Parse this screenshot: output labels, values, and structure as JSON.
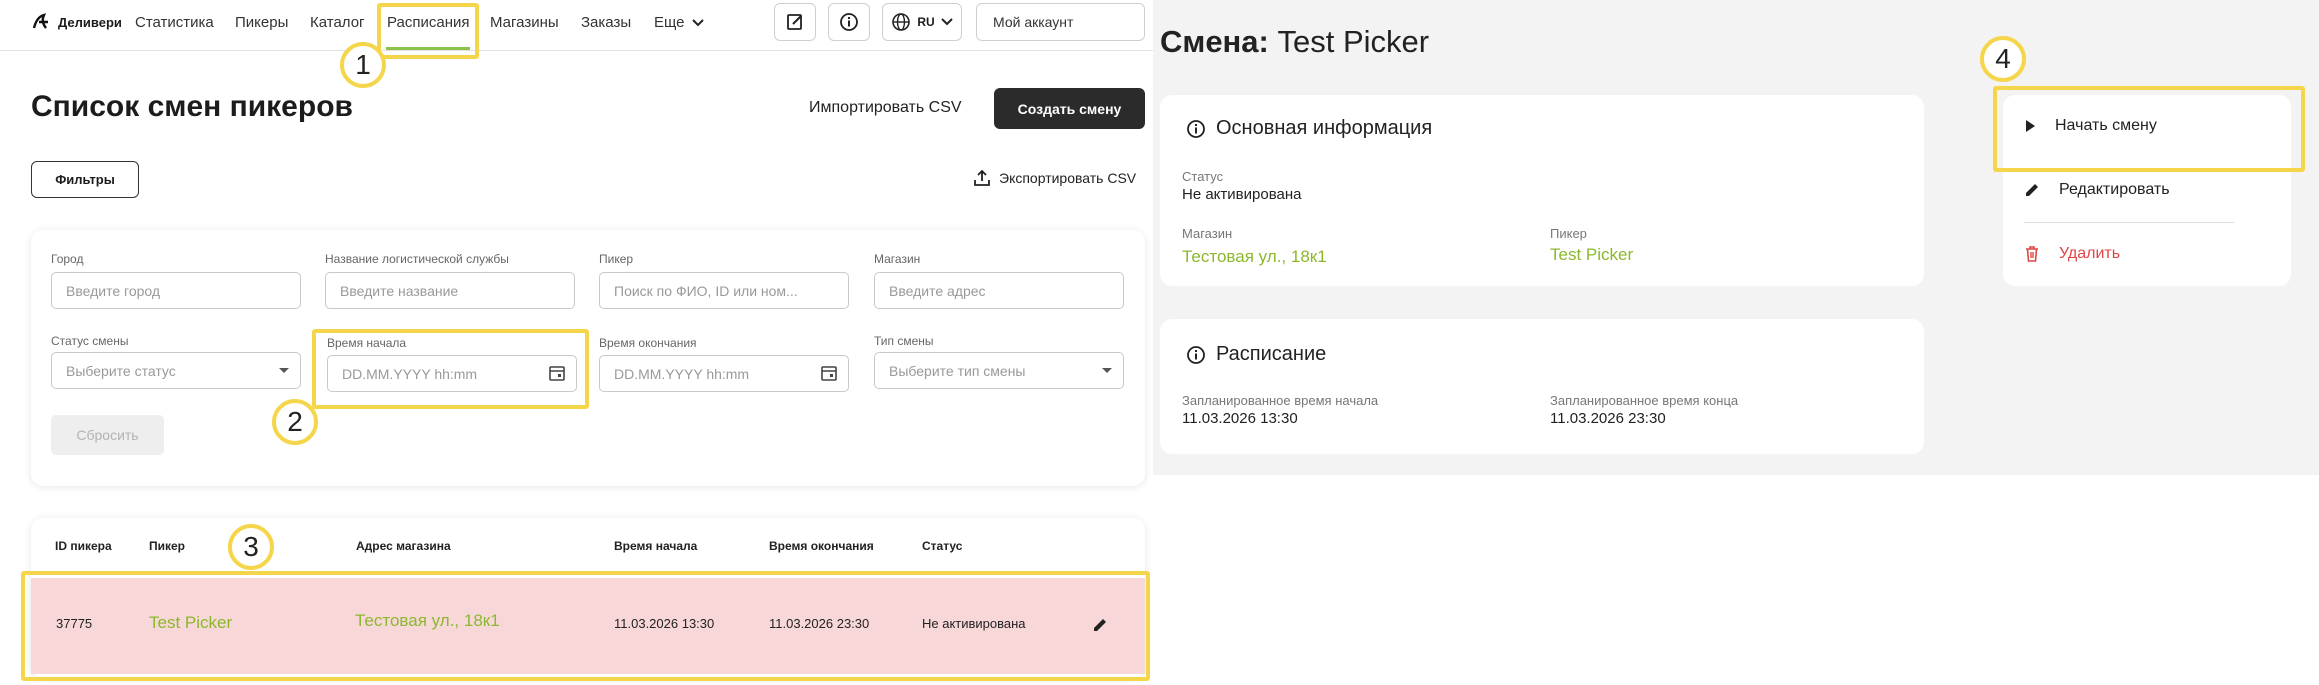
{
  "nav": {
    "logo_text": "Деливери",
    "items": [
      "Статистика",
      "Пикеры",
      "Каталог",
      "Расписания",
      "Магазины",
      "Заказы"
    ],
    "more_label": "Еще",
    "lang": "RU",
    "account": "Мой аккаунт"
  },
  "page": {
    "title": "Список смен пикеров",
    "import_label": "Импортировать CSV",
    "create_label": "Создать смену",
    "filters_label": "Фильтры",
    "export_label": "Экспортировать CSV"
  },
  "filters": {
    "city": {
      "label": "Город",
      "placeholder": "Введите город"
    },
    "logistics": {
      "label": "Название логистической службы",
      "placeholder": "Введите название"
    },
    "picker": {
      "label": "Пикер",
      "placeholder": "Поиск по ФИО, ID или ном..."
    },
    "store": {
      "label": "Магазин",
      "placeholder": "Введите адрес"
    },
    "status": {
      "label": "Статус смены",
      "placeholder": "Выберите статус"
    },
    "start": {
      "label": "Время начала",
      "placeholder": "DD.MM.YYYY hh:mm"
    },
    "end": {
      "label": "Время окончания",
      "placeholder": "DD.MM.YYYY hh:mm"
    },
    "type": {
      "label": "Тип смены",
      "placeholder": "Выберите тип смены"
    },
    "reset_label": "Сбросить"
  },
  "table": {
    "headers": [
      "ID пикера",
      "Пикер",
      "Адрес магазина",
      "Время начала",
      "Время окончания",
      "Статус"
    ],
    "row": {
      "id": "37775",
      "picker": "Test Picker",
      "address": "Тестовая ул., 18к1",
      "start": "11.03.2026 13:30",
      "end": "11.03.2026 23:30",
      "status": "Не активирована"
    }
  },
  "detail": {
    "title_prefix": "Смена:",
    "title_name": "Test Picker",
    "main_info": {
      "heading": "Основная информация",
      "status_label": "Статус",
      "status_value": "Не активирована",
      "store_label": "Магазин",
      "store_value": "Тестовая ул., 18к1",
      "picker_label": "Пикер",
      "picker_value": "Test Picker"
    },
    "schedule": {
      "heading": "Расписание",
      "start_label": "Запланированное время начала",
      "start_value": "11.03.2026 13:30",
      "end_label": "Запланированное время конца",
      "end_value": "11.03.2026 23:30"
    },
    "actions": {
      "start": "Начать смену",
      "edit": "Редактировать",
      "delete": "Удалить"
    }
  },
  "markers": [
    "1",
    "2",
    "3",
    "4"
  ],
  "colors": {
    "accent": "#8bc34a",
    "highlight": "#f5d64b",
    "row_bg": "#f8d7d9",
    "danger": "#e04545"
  }
}
